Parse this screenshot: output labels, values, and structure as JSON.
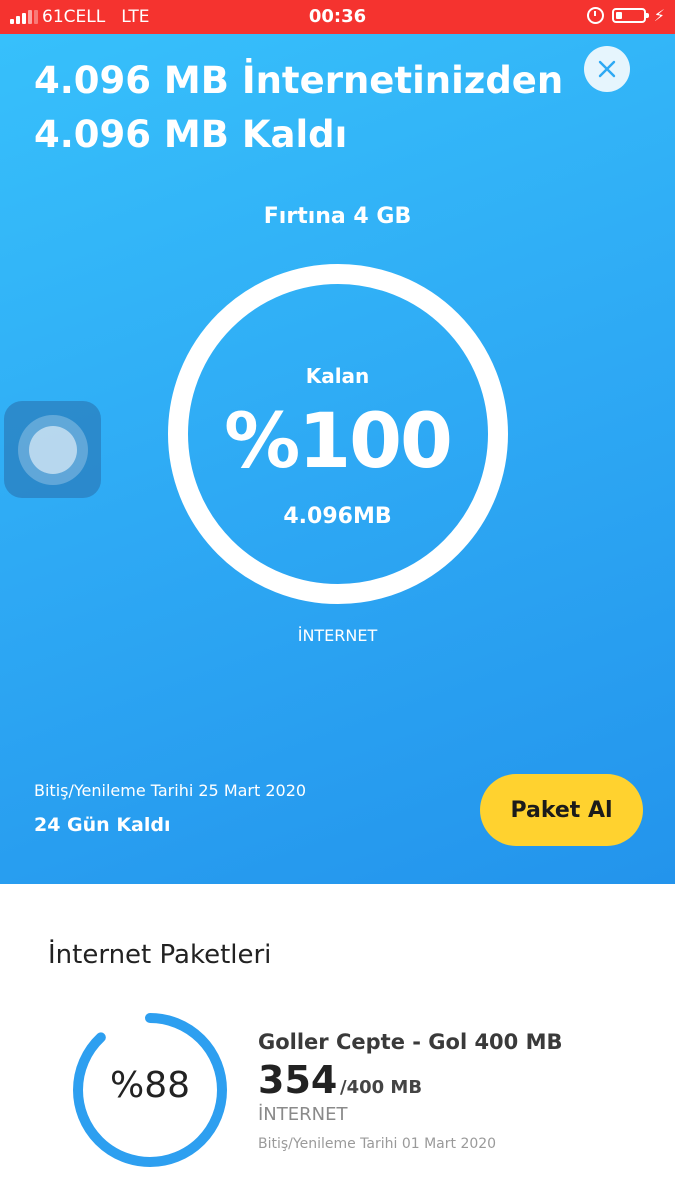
{
  "status_bar": {
    "carrier": "61CELL",
    "network": "LTE",
    "time": "00:36",
    "accent": "#f5332f"
  },
  "hero": {
    "title_line1": "4.096 MB İnternetinizden",
    "title_line2": "4.096 MB Kaldı",
    "package_name": "Fırtına 4 GB",
    "ring_label": "Kalan",
    "percent": "%100",
    "amount": "4.096MB",
    "type": "İNTERNET",
    "renewal_date": "Bitiş/Yenileme Tarihi 25 Mart 2020",
    "days_left": "24 Gün Kaldı",
    "buy_button": "Paket Al",
    "remaining_fraction": 1.0,
    "colors": {
      "background": "#2ea9f4",
      "button": "#ffd22f"
    }
  },
  "internet_packages": {
    "title": "İnternet Paketleri",
    "items": [
      {
        "percent": "%88",
        "name": "Goller Cepte - Gol 400 MB",
        "remaining": "354",
        "total": "/400 MB",
        "type": "İNTERNET",
        "renewal_date": "Bitiş/Yenileme Tarihi 01 Mart 2020",
        "remaining_fraction": 0.88
      }
    ],
    "ring_color": "#2d9ff0"
  },
  "icons": {
    "close": "close-icon",
    "signal": "signal-icon",
    "alarm": "alarm-icon",
    "battery": "battery-icon",
    "charging": "charging-icon",
    "assistive_touch": "assistive-touch-icon"
  }
}
